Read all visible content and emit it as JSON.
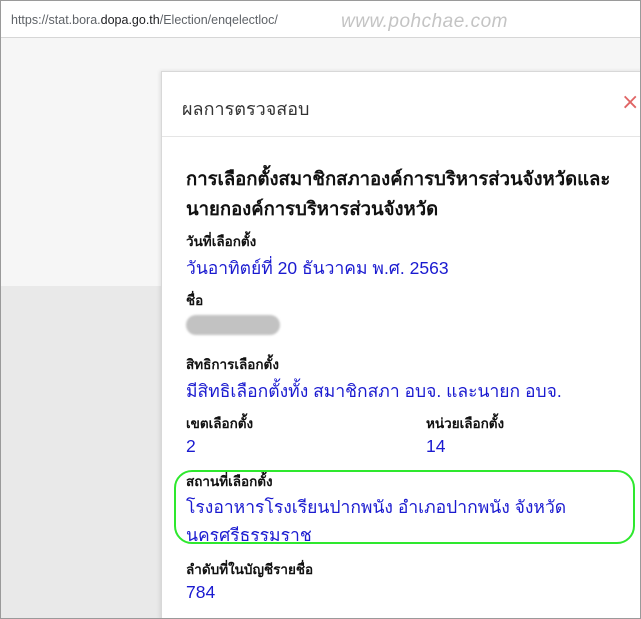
{
  "browser": {
    "url_prefix": "https://stat.bora.",
    "url_domain": "dopa.go.th",
    "url_path": "/Election/enqelectloc/",
    "watermark": "www.pohchae.com"
  },
  "modal": {
    "title": "ผลการตรวจสอบ",
    "close": "×",
    "election_title": "การเลือกตั้งสมาชิกสภาองค์การบริหารส่วนจังหวัดและนายกองค์การบริหารส่วนจังหวัด",
    "date_label": "วันที่เลือกตั้ง",
    "date_value": "วันอาทิตย์ที่ 20 ธันวาคม พ.ศ. 2563",
    "name_label": "ชื่อ",
    "right_label": "สิทธิการเลือกตั้ง",
    "right_value": "มีสิทธิเลือกตั้งทั้ง สมาชิกสภา อบจ. และนายก อบจ.",
    "district_label": "เขตเลือกตั้ง",
    "district_value": "2",
    "unit_label": "หน่วยเลือกตั้ง",
    "unit_value": "14",
    "station_label": "สถานที่เลือกตั้ง",
    "station_value": "โรงอาหารโรงเรียนปากพนัง อำเภอปากพนัง จังหวัดนครศรีธรรมราช",
    "order_label": "ลำดับที่ในบัญชีรายชื่อ",
    "order_value": "784"
  },
  "colors": {
    "link_blue": "#1a1ad0",
    "highlight_green": "#2ee82e",
    "close_red": "#e06565"
  }
}
